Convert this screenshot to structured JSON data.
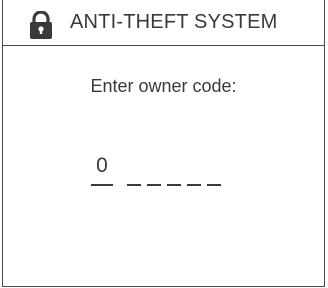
{
  "header": {
    "icon": "lock-icon",
    "title": "ANTI-THEFT SYSTEM"
  },
  "prompt": "Enter owner code:",
  "code": {
    "digits": [
      "0",
      "",
      "",
      "",
      "",
      ""
    ],
    "active_index": 0
  }
}
